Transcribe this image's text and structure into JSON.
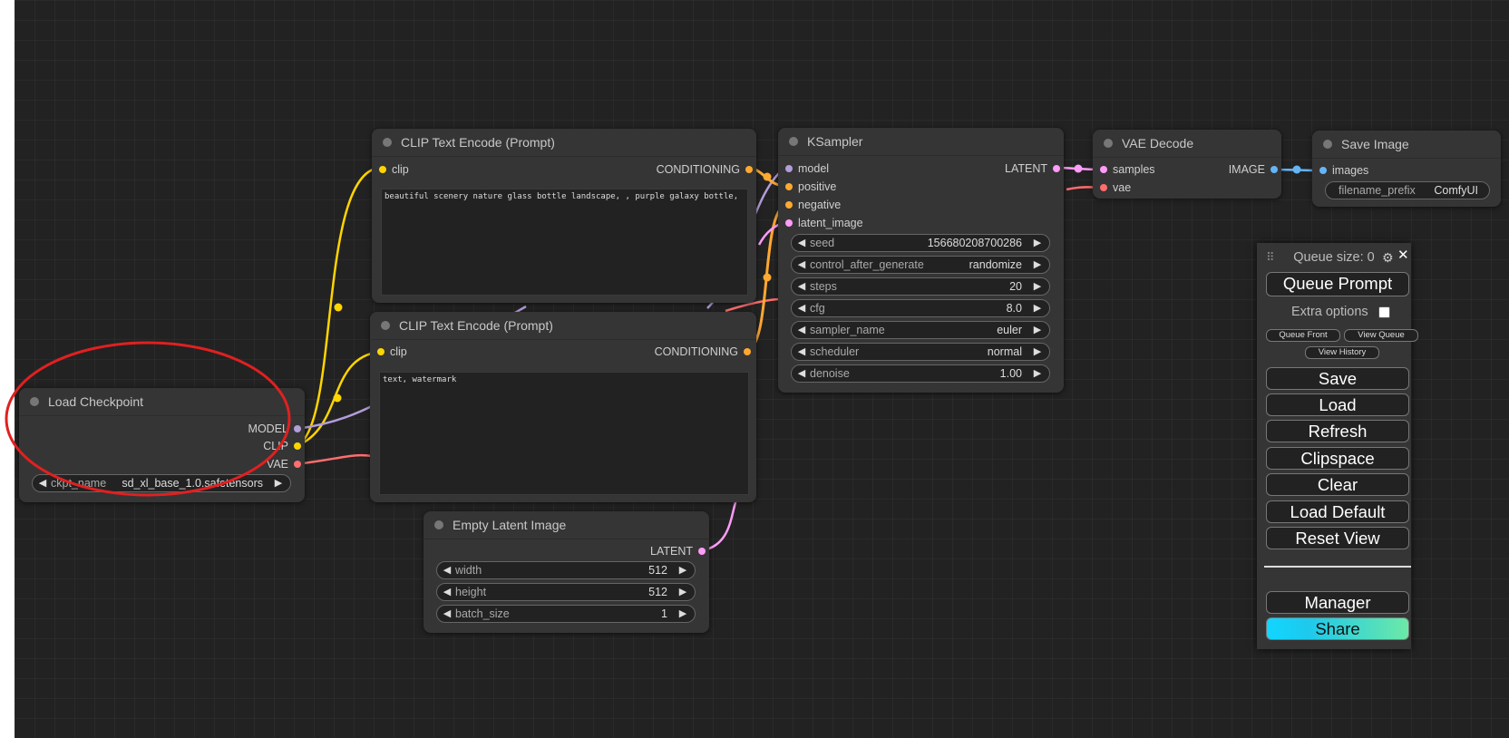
{
  "nodes": {
    "clip_top": {
      "title": "CLIP Text Encode (Prompt)",
      "input": "clip",
      "output": "CONDITIONING",
      "text": "beautiful scenery nature glass bottle landscape, , purple galaxy bottle,"
    },
    "clip_bottom": {
      "title": "CLIP Text Encode (Prompt)",
      "input": "clip",
      "output": "CONDITIONING",
      "text": "text, watermark"
    },
    "ksampler": {
      "title": "KSampler",
      "inputs": [
        "model",
        "positive",
        "negative",
        "latent_image"
      ],
      "output": "LATENT",
      "widgets": [
        {
          "name": "seed",
          "value": "156680208700286"
        },
        {
          "name": "control_after_generate",
          "value": "randomize"
        },
        {
          "name": "steps",
          "value": "20"
        },
        {
          "name": "cfg",
          "value": "8.0"
        },
        {
          "name": "sampler_name",
          "value": "euler"
        },
        {
          "name": "scheduler",
          "value": "normal"
        },
        {
          "name": "denoise",
          "value": "1.00"
        }
      ]
    },
    "vae_decode": {
      "title": "VAE Decode",
      "inputs": [
        "samples",
        "vae"
      ],
      "output": "IMAGE"
    },
    "save_image": {
      "title": "Save Image",
      "input": "images",
      "widget": {
        "name": "filename_prefix",
        "value": "ComfyUI"
      }
    },
    "load_checkpoint": {
      "title": "Load Checkpoint",
      "outputs": [
        "MODEL",
        "CLIP",
        "VAE"
      ],
      "widget": {
        "name": "ckpt_name",
        "value": "sd_xl_base_1.0.safetensors"
      }
    },
    "empty_latent": {
      "title": "Empty Latent Image",
      "output": "LATENT",
      "widgets": [
        {
          "name": "width",
          "value": "512"
        },
        {
          "name": "height",
          "value": "512"
        },
        {
          "name": "batch_size",
          "value": "1"
        }
      ]
    }
  },
  "menu": {
    "queue_size": "Queue size: 0",
    "queue_prompt": "Queue Prompt",
    "extra_options": "Extra options",
    "queue_front": "Queue Front",
    "view_queue": "View Queue",
    "view_history": "View History",
    "save": "Save",
    "load": "Load",
    "refresh": "Refresh",
    "clipspace": "Clipspace",
    "clear": "Clear",
    "load_default": "Load Default",
    "reset_view": "Reset View",
    "manager": "Manager",
    "share": "Share"
  },
  "colors": {
    "model": "#b39ddb",
    "clip": "#ffd500",
    "vae": "#ff6e6e",
    "conditioning": "#ffa931",
    "latent": "#ff9cf9",
    "image": "#64b5f6",
    "highlight": "#e02020"
  }
}
